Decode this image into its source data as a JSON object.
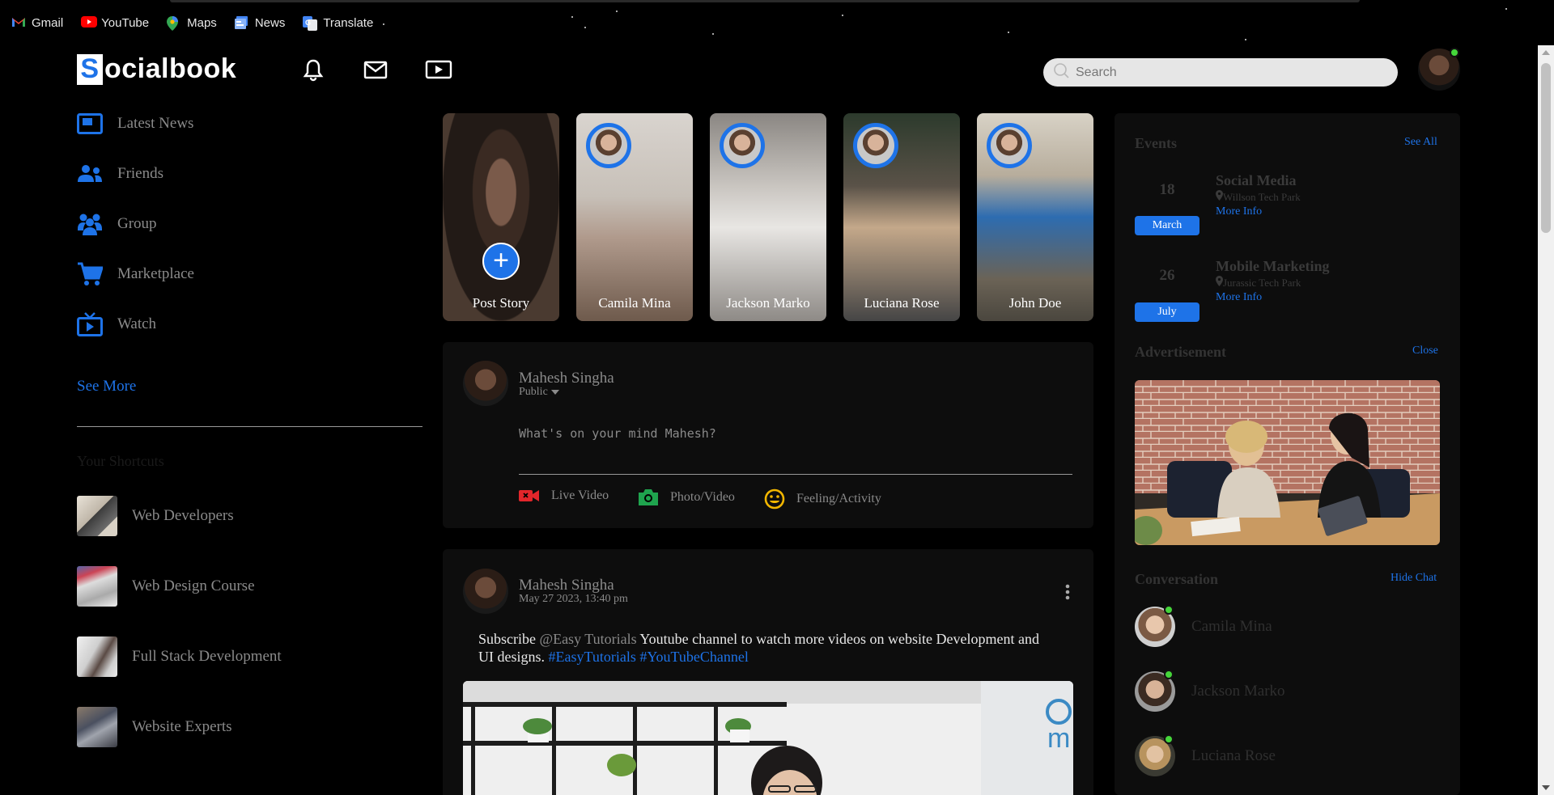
{
  "bookmarks": [
    {
      "label": "Gmail",
      "icon": "gmail-icon"
    },
    {
      "label": "YouTube",
      "icon": "youtube-icon"
    },
    {
      "label": "Maps",
      "icon": "maps-icon"
    },
    {
      "label": "News",
      "icon": "news-icon"
    },
    {
      "label": "Translate",
      "icon": "translate-icon"
    }
  ],
  "header": {
    "logo_letter": "S",
    "logo_rest": "ocialbook",
    "search_placeholder": "Search",
    "icons": [
      "bell-icon",
      "mail-icon",
      "video-icon"
    ]
  },
  "sidebar": {
    "items": [
      {
        "label": "Latest News",
        "icon": "news-feed-icon"
      },
      {
        "label": "Friends",
        "icon": "friends-icon"
      },
      {
        "label": "Group",
        "icon": "group-icon"
      },
      {
        "label": "Marketplace",
        "icon": "cart-icon"
      },
      {
        "label": "Watch",
        "icon": "tv-icon"
      }
    ],
    "see_more": "See More",
    "shortcuts_title": "Your Shortcuts",
    "shortcuts": [
      {
        "label": "Web Developers"
      },
      {
        "label": "Web Design Course"
      },
      {
        "label": "Full Stack Development"
      },
      {
        "label": "Website Experts"
      }
    ]
  },
  "stories": [
    {
      "label": "Post Story"
    },
    {
      "label": "Camila Mina"
    },
    {
      "label": "Jackson Marko"
    },
    {
      "label": "Luciana Rose"
    },
    {
      "label": "John Doe"
    }
  ],
  "composer": {
    "user_name": "Mahesh Singha",
    "privacy": "Public",
    "placeholder": "What's on your mind Mahesh?",
    "actions": [
      {
        "label": "Live Video",
        "color": "#e3262b"
      },
      {
        "label": "Photo/Video",
        "color": "#1fa44e"
      },
      {
        "label": "Feeling/Activity",
        "color": "#f2b600"
      }
    ]
  },
  "post": {
    "user_name": "Mahesh Singha",
    "timestamp": "May 27 2023, 13:40 pm",
    "text_a": "Subscribe ",
    "mention": "@Easy Tutorials",
    "text_b": " Youtube channel to watch more videos on website Development and UI designs. ",
    "tag1": "#EasyTutorials",
    "tag2": "#YouTubeChannel"
  },
  "right": {
    "events_title": "Events",
    "see_all": "See All",
    "events": [
      {
        "day": "18",
        "month": "March",
        "title": "Social Media",
        "location": "Willson Tech Park",
        "more": "More Info"
      },
      {
        "day": "26",
        "month": "July",
        "title": "Mobile Marketing",
        "location": "Jurassic Tech Park",
        "more": "More Info"
      }
    ],
    "ad_title": "Advertisement",
    "ad_close": "Close",
    "conversation_title": "Conversation",
    "hide_chat": "Hide Chat",
    "chats": [
      {
        "name": "Camila Mina"
      },
      {
        "name": "Jackson Marko"
      },
      {
        "name": "Luciana Rose"
      }
    ]
  },
  "colors": {
    "accent": "#1e73e8",
    "online": "#45d63a"
  }
}
